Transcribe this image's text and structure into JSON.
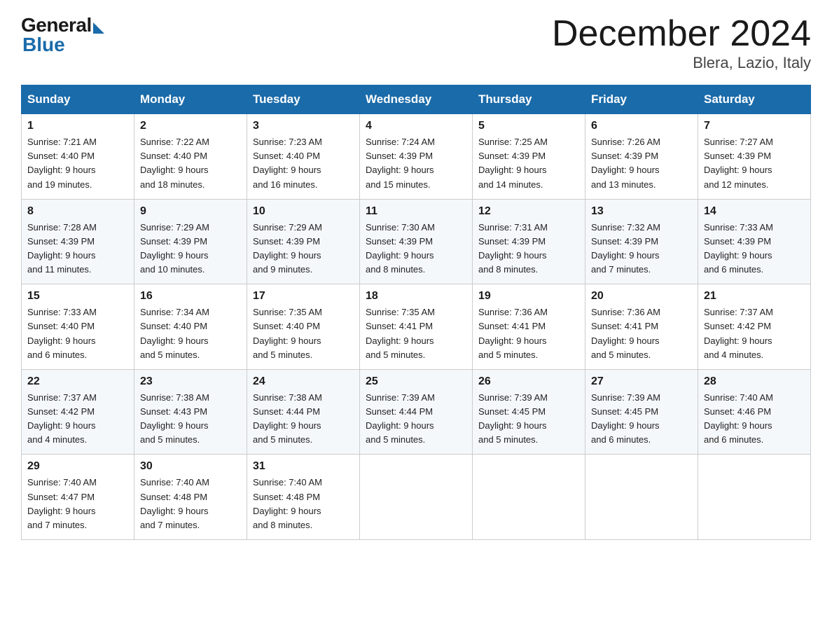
{
  "logo": {
    "general": "General",
    "blue": "Blue"
  },
  "header": {
    "month": "December 2024",
    "location": "Blera, Lazio, Italy"
  },
  "weekdays": [
    "Sunday",
    "Monday",
    "Tuesday",
    "Wednesday",
    "Thursday",
    "Friday",
    "Saturday"
  ],
  "weeks": [
    [
      {
        "day": "1",
        "info": "Sunrise: 7:21 AM\nSunset: 4:40 PM\nDaylight: 9 hours\nand 19 minutes."
      },
      {
        "day": "2",
        "info": "Sunrise: 7:22 AM\nSunset: 4:40 PM\nDaylight: 9 hours\nand 18 minutes."
      },
      {
        "day": "3",
        "info": "Sunrise: 7:23 AM\nSunset: 4:40 PM\nDaylight: 9 hours\nand 16 minutes."
      },
      {
        "day": "4",
        "info": "Sunrise: 7:24 AM\nSunset: 4:39 PM\nDaylight: 9 hours\nand 15 minutes."
      },
      {
        "day": "5",
        "info": "Sunrise: 7:25 AM\nSunset: 4:39 PM\nDaylight: 9 hours\nand 14 minutes."
      },
      {
        "day": "6",
        "info": "Sunrise: 7:26 AM\nSunset: 4:39 PM\nDaylight: 9 hours\nand 13 minutes."
      },
      {
        "day": "7",
        "info": "Sunrise: 7:27 AM\nSunset: 4:39 PM\nDaylight: 9 hours\nand 12 minutes."
      }
    ],
    [
      {
        "day": "8",
        "info": "Sunrise: 7:28 AM\nSunset: 4:39 PM\nDaylight: 9 hours\nand 11 minutes."
      },
      {
        "day": "9",
        "info": "Sunrise: 7:29 AM\nSunset: 4:39 PM\nDaylight: 9 hours\nand 10 minutes."
      },
      {
        "day": "10",
        "info": "Sunrise: 7:29 AM\nSunset: 4:39 PM\nDaylight: 9 hours\nand 9 minutes."
      },
      {
        "day": "11",
        "info": "Sunrise: 7:30 AM\nSunset: 4:39 PM\nDaylight: 9 hours\nand 8 minutes."
      },
      {
        "day": "12",
        "info": "Sunrise: 7:31 AM\nSunset: 4:39 PM\nDaylight: 9 hours\nand 8 minutes."
      },
      {
        "day": "13",
        "info": "Sunrise: 7:32 AM\nSunset: 4:39 PM\nDaylight: 9 hours\nand 7 minutes."
      },
      {
        "day": "14",
        "info": "Sunrise: 7:33 AM\nSunset: 4:39 PM\nDaylight: 9 hours\nand 6 minutes."
      }
    ],
    [
      {
        "day": "15",
        "info": "Sunrise: 7:33 AM\nSunset: 4:40 PM\nDaylight: 9 hours\nand 6 minutes."
      },
      {
        "day": "16",
        "info": "Sunrise: 7:34 AM\nSunset: 4:40 PM\nDaylight: 9 hours\nand 5 minutes."
      },
      {
        "day": "17",
        "info": "Sunrise: 7:35 AM\nSunset: 4:40 PM\nDaylight: 9 hours\nand 5 minutes."
      },
      {
        "day": "18",
        "info": "Sunrise: 7:35 AM\nSunset: 4:41 PM\nDaylight: 9 hours\nand 5 minutes."
      },
      {
        "day": "19",
        "info": "Sunrise: 7:36 AM\nSunset: 4:41 PM\nDaylight: 9 hours\nand 5 minutes."
      },
      {
        "day": "20",
        "info": "Sunrise: 7:36 AM\nSunset: 4:41 PM\nDaylight: 9 hours\nand 5 minutes."
      },
      {
        "day": "21",
        "info": "Sunrise: 7:37 AM\nSunset: 4:42 PM\nDaylight: 9 hours\nand 4 minutes."
      }
    ],
    [
      {
        "day": "22",
        "info": "Sunrise: 7:37 AM\nSunset: 4:42 PM\nDaylight: 9 hours\nand 4 minutes."
      },
      {
        "day": "23",
        "info": "Sunrise: 7:38 AM\nSunset: 4:43 PM\nDaylight: 9 hours\nand 5 minutes."
      },
      {
        "day": "24",
        "info": "Sunrise: 7:38 AM\nSunset: 4:44 PM\nDaylight: 9 hours\nand 5 minutes."
      },
      {
        "day": "25",
        "info": "Sunrise: 7:39 AM\nSunset: 4:44 PM\nDaylight: 9 hours\nand 5 minutes."
      },
      {
        "day": "26",
        "info": "Sunrise: 7:39 AM\nSunset: 4:45 PM\nDaylight: 9 hours\nand 5 minutes."
      },
      {
        "day": "27",
        "info": "Sunrise: 7:39 AM\nSunset: 4:45 PM\nDaylight: 9 hours\nand 6 minutes."
      },
      {
        "day": "28",
        "info": "Sunrise: 7:40 AM\nSunset: 4:46 PM\nDaylight: 9 hours\nand 6 minutes."
      }
    ],
    [
      {
        "day": "29",
        "info": "Sunrise: 7:40 AM\nSunset: 4:47 PM\nDaylight: 9 hours\nand 7 minutes."
      },
      {
        "day": "30",
        "info": "Sunrise: 7:40 AM\nSunset: 4:48 PM\nDaylight: 9 hours\nand 7 minutes."
      },
      {
        "day": "31",
        "info": "Sunrise: 7:40 AM\nSunset: 4:48 PM\nDaylight: 9 hours\nand 8 minutes."
      },
      {
        "day": "",
        "info": ""
      },
      {
        "day": "",
        "info": ""
      },
      {
        "day": "",
        "info": ""
      },
      {
        "day": "",
        "info": ""
      }
    ]
  ]
}
